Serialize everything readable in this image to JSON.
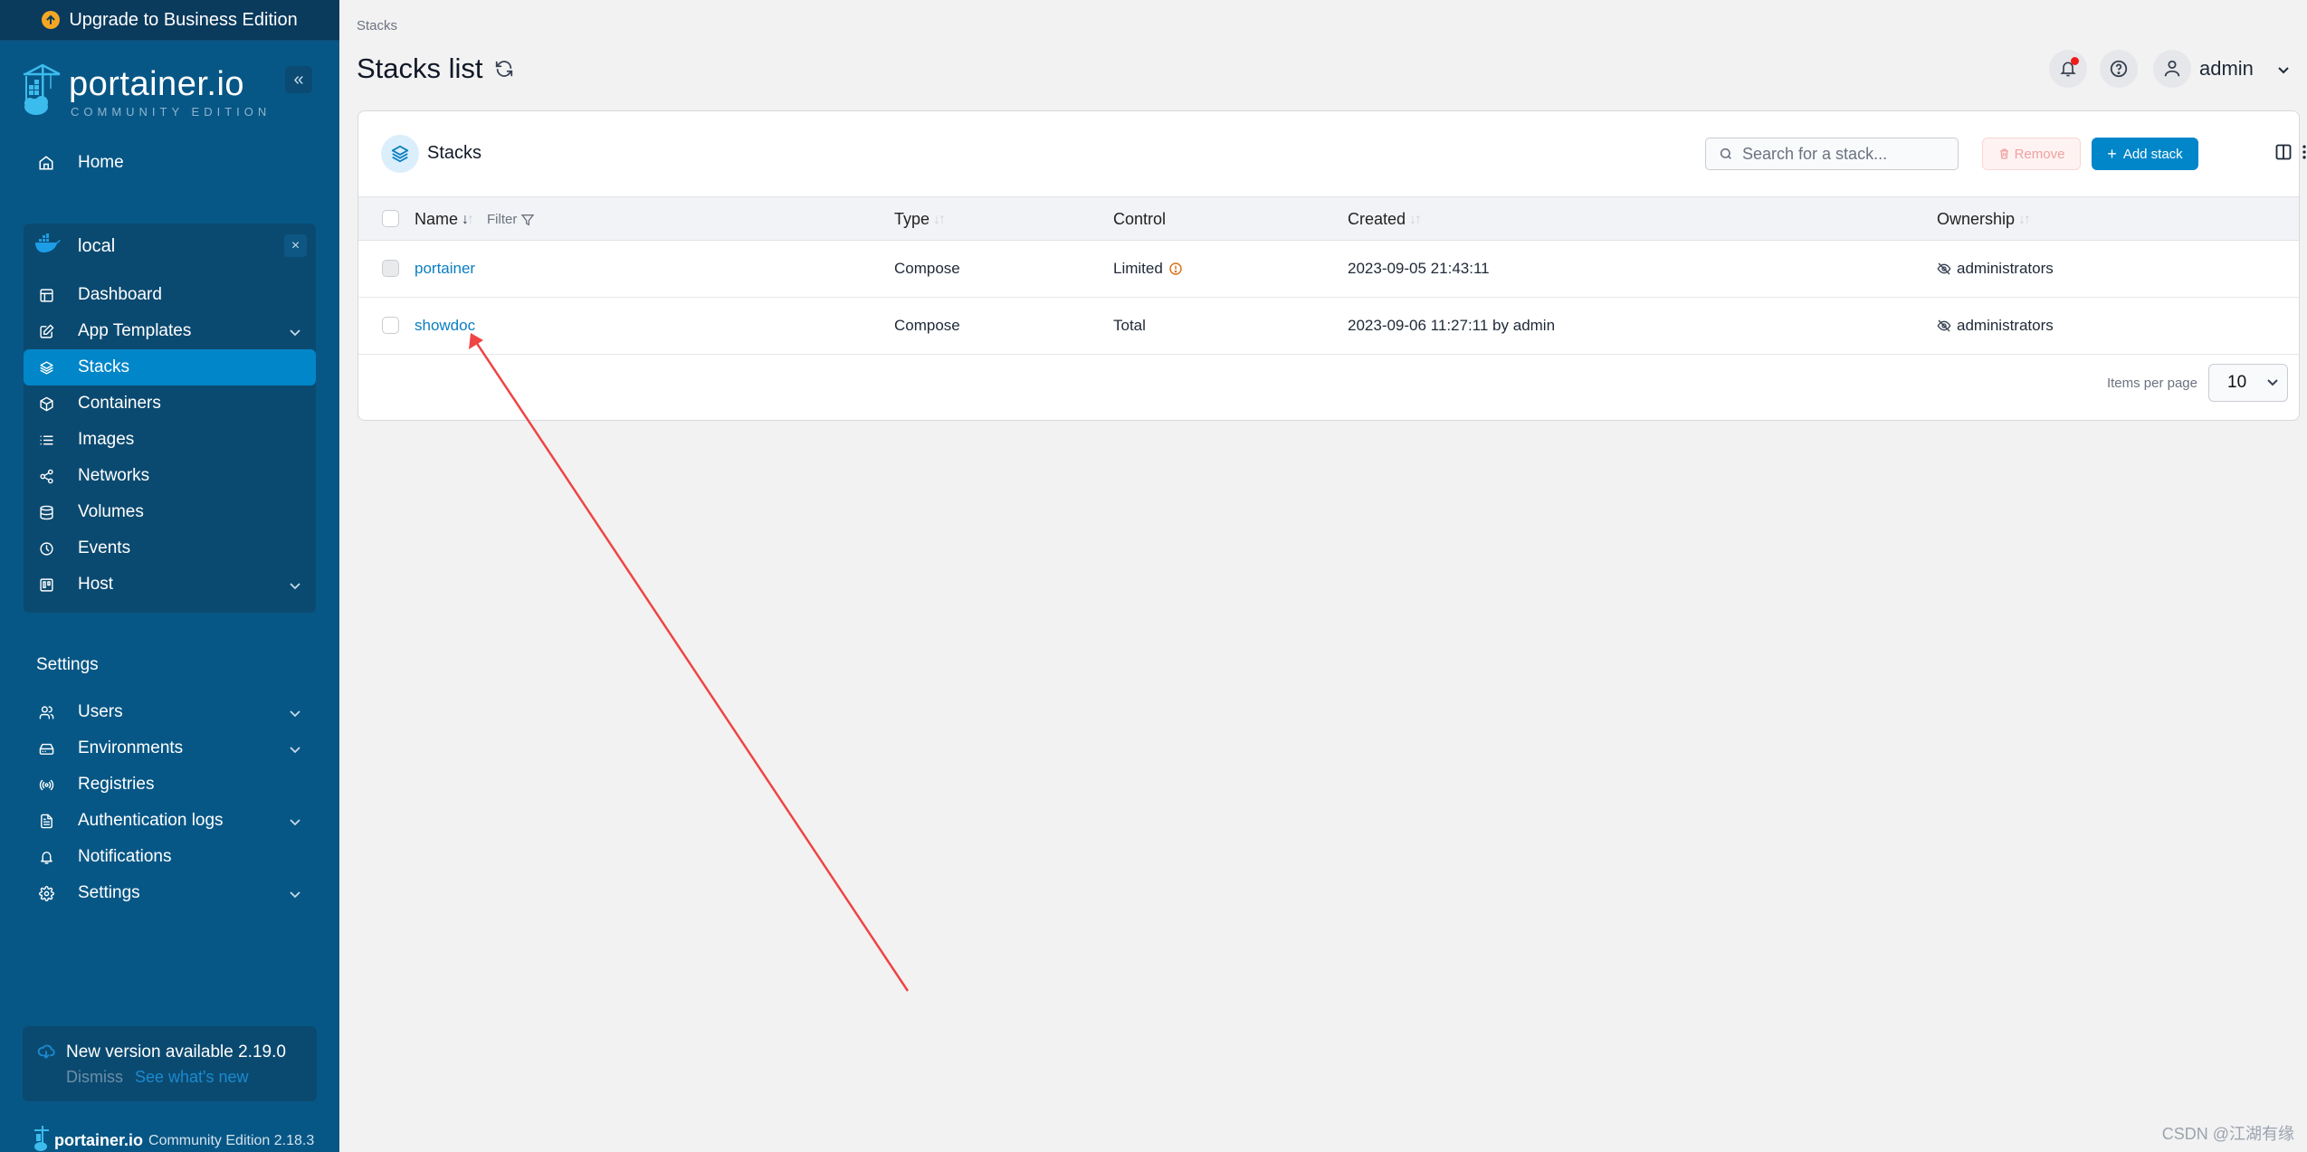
{
  "sidebar": {
    "upgrade_label": "Upgrade to Business Edition",
    "brand_name": "portainer.io",
    "brand_edition": "COMMUNITY EDITION",
    "collapse_label": "«",
    "home_label": "Home",
    "environment": {
      "name": "local",
      "close_label": "×"
    },
    "env_items": [
      {
        "label": "Dashboard",
        "icon": "dashboard-icon",
        "expandable": false
      },
      {
        "label": "App Templates",
        "icon": "edit-icon",
        "expandable": true
      },
      {
        "label": "Stacks",
        "icon": "layers-icon",
        "expandable": false,
        "active": true
      },
      {
        "label": "Containers",
        "icon": "box-icon",
        "expandable": false
      },
      {
        "label": "Images",
        "icon": "list-icon",
        "expandable": false
      },
      {
        "label": "Networks",
        "icon": "share-icon",
        "expandable": false
      },
      {
        "label": "Volumes",
        "icon": "database-icon",
        "expandable": false
      },
      {
        "label": "Events",
        "icon": "clock-icon",
        "expandable": false
      },
      {
        "label": "Host",
        "icon": "trello-icon",
        "expandable": true
      }
    ],
    "settings_title": "Settings",
    "settings_items": [
      {
        "label": "Users",
        "icon": "users-icon",
        "expandable": true
      },
      {
        "label": "Environments",
        "icon": "hard-drive-icon",
        "expandable": true
      },
      {
        "label": "Registries",
        "icon": "radio-icon",
        "expandable": false
      },
      {
        "label": "Authentication logs",
        "icon": "file-text-icon",
        "expandable": true
      },
      {
        "label": "Notifications",
        "icon": "bell-icon",
        "expandable": false
      },
      {
        "label": "Settings",
        "icon": "settings-icon",
        "expandable": true
      }
    ],
    "update": {
      "text": "New version available 2.19.0",
      "dismiss": "Dismiss",
      "whats_new": "See what's new"
    },
    "footer": {
      "brand": "portainer.io",
      "edition": "Community Edition 2.18.3"
    }
  },
  "header": {
    "breadcrumb": "Stacks",
    "title": "Stacks list",
    "user": "admin"
  },
  "card": {
    "title": "Stacks",
    "search_placeholder": "Search for a stack...",
    "search_value": "",
    "remove_label": "Remove",
    "add_label": "Add stack",
    "columns": [
      "Name",
      "Type",
      "Control",
      "Created",
      "Ownership"
    ],
    "filter_label": "Filter",
    "rows": [
      {
        "name": "portainer",
        "type": "Compose",
        "control": "Limited",
        "control_warning": true,
        "created": "2023-09-05 21:43:11",
        "ownership": "administrators",
        "selectable": false
      },
      {
        "name": "showdoc",
        "type": "Compose",
        "control": "Total",
        "control_warning": false,
        "created": "2023-09-06 11:27:11 by admin",
        "ownership": "administrators",
        "selectable": true
      }
    ],
    "items_per_page_label": "Items per page",
    "items_per_page": "10"
  },
  "colors": {
    "sidebar_bg": "#075786",
    "accent": "#0086c9",
    "link": "#0a7ec2",
    "warning": "#d9731a",
    "annotation_arrow": "#ef4444"
  },
  "watermark": "CSDN @江湖有缘"
}
